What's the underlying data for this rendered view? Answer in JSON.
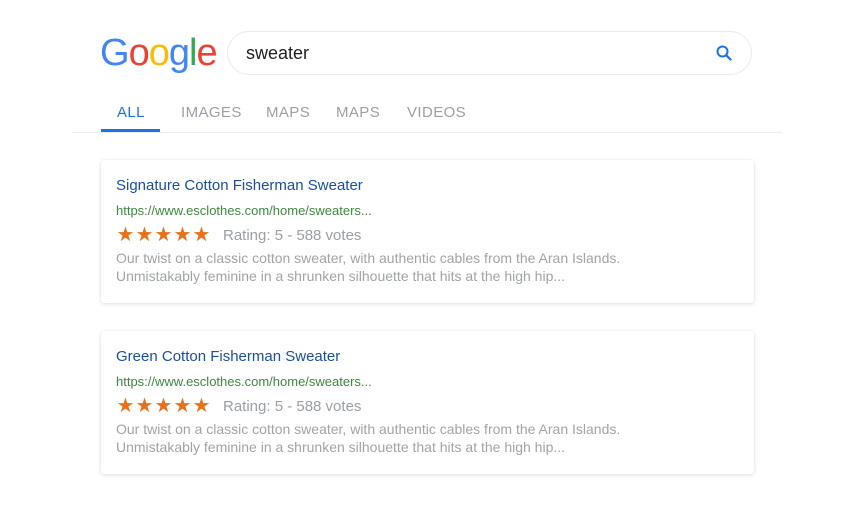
{
  "logo": {
    "letters": [
      {
        "ch": "G",
        "color": "#4285f4"
      },
      {
        "ch": "o",
        "color": "#ea4335"
      },
      {
        "ch": "o",
        "color": "#fbbc05"
      },
      {
        "ch": "g",
        "color": "#4285f4"
      },
      {
        "ch": "l",
        "color": "#34a853"
      },
      {
        "ch": "e",
        "color": "#ea4335"
      }
    ]
  },
  "search": {
    "value": "sweater",
    "icon": "search-icon",
    "icon_color": "#1a73e8"
  },
  "tabs": [
    {
      "label": "ALL",
      "active": true
    },
    {
      "label": "IMAGES",
      "active": false
    },
    {
      "label": "MAPS",
      "active": false
    },
    {
      "label": "MAPS",
      "active": false
    },
    {
      "label": "VIDEOS",
      "active": false
    }
  ],
  "results": [
    {
      "title": "Signature Cotton Fisherman Sweater",
      "url": "https://www.esclothes.com/home/sweaters...",
      "stars": 5,
      "rating_text": "Rating: 5 - 588 votes",
      "snippet_line1": "Our twist on a classic cotton sweater, with authentic cables from the Aran Islands.",
      "snippet_line2": "Unmistakably feminine in a shrunken silhouette that hits at the high hip..."
    },
    {
      "title": "Green Cotton Fisherman Sweater",
      "url": "https://www.esclothes.com/home/sweaters...",
      "stars": 5,
      "rating_text": "Rating: 5 - 588 votes",
      "snippet_line1": "Our twist on a classic cotton sweater, with authentic cables from the Aran Islands.",
      "snippet_line2": "Unmistakably feminine in a shrunken silhouette that hits at the high hip..."
    }
  ],
  "colors": {
    "link": "#1a4fa0",
    "url": "#3c8a3c",
    "star": "#e8711a",
    "accent": "#1a73e8",
    "muted": "#9aa0a6"
  }
}
